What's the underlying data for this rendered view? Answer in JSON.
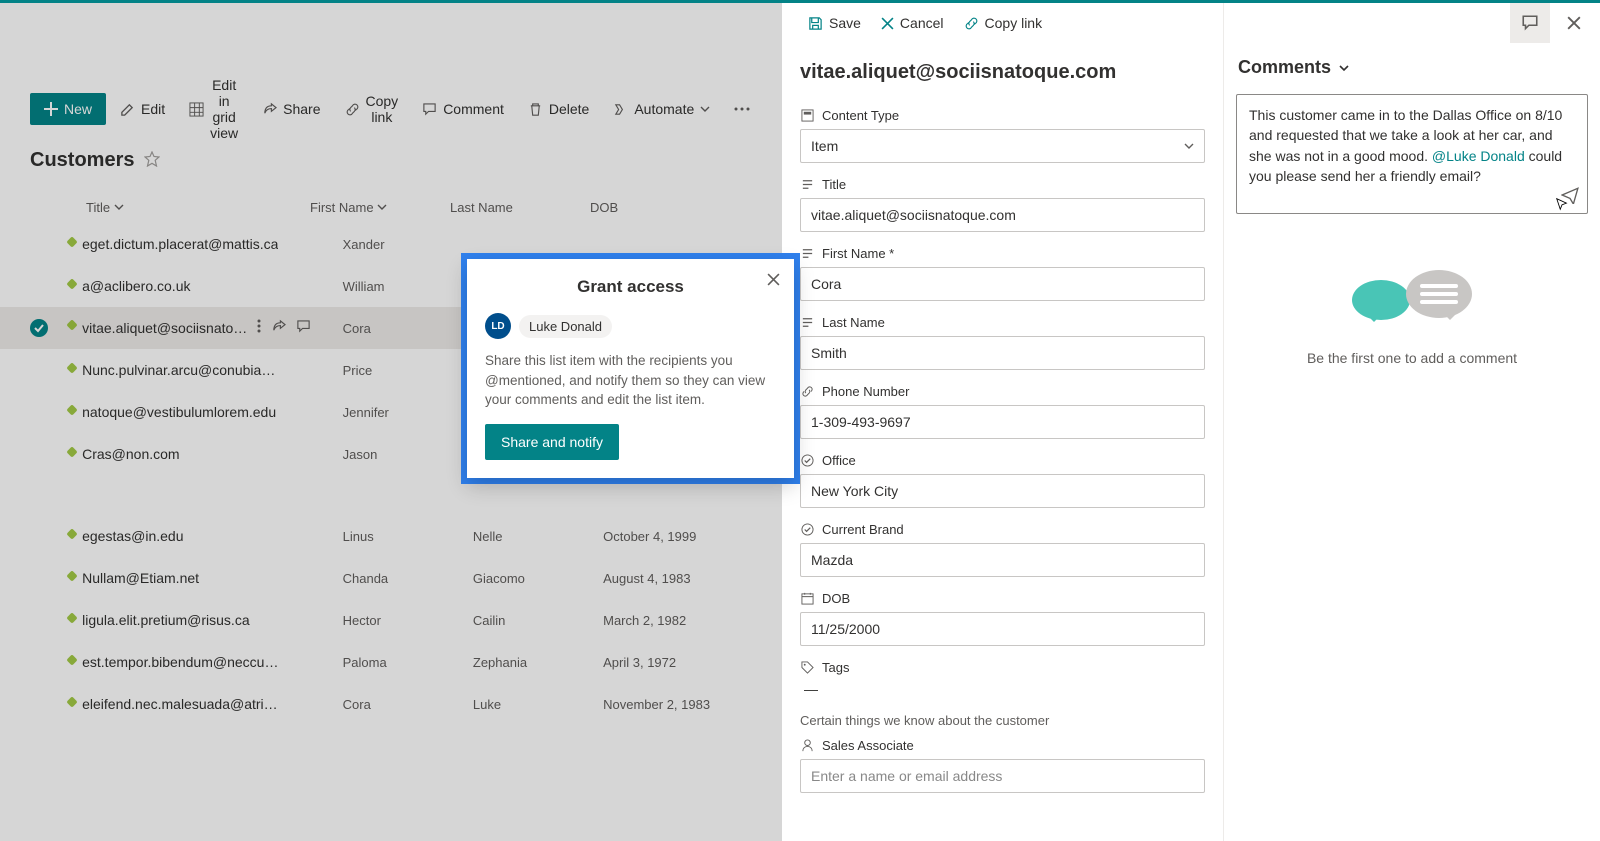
{
  "toolbar": {
    "new_label": "New",
    "edit_label": "Edit",
    "edit_grid_label": "Edit in grid view",
    "share_label": "Share",
    "copy_link_label": "Copy link",
    "comment_label": "Comment",
    "delete_label": "Delete",
    "automate_label": "Automate"
  },
  "list": {
    "title": "Customers",
    "columns": {
      "title": "Title",
      "first_name": "First Name",
      "last_name": "Last Name",
      "dob": "DOB"
    },
    "rows": [
      {
        "title": "eget.dictum.placerat@mattis.ca",
        "first_name": "Xander",
        "last_name": "",
        "dob": ""
      },
      {
        "title": "a@aclibero.co.uk",
        "first_name": "William",
        "last_name": "",
        "dob": ""
      },
      {
        "title": "vitae.aliquet@sociisnato…",
        "first_name": "Cora",
        "last_name": "",
        "dob": "",
        "selected": true
      },
      {
        "title": "Nunc.pulvinar.arcu@conubianostraper.edu",
        "first_name": "Price",
        "last_name": "",
        "dob": ""
      },
      {
        "title": "natoque@vestibulumlorem.edu",
        "first_name": "Jennifer",
        "last_name": "",
        "dob": ""
      },
      {
        "title": "Cras@non.com",
        "first_name": "Jason",
        "last_name": "",
        "dob": ""
      },
      {
        "title": "egestas@in.edu",
        "first_name": "Linus",
        "last_name": "Nelle",
        "dob": "October 4, 1999"
      },
      {
        "title": "Nullam@Etiam.net",
        "first_name": "Chanda",
        "last_name": "Giacomo",
        "dob": "August 4, 1983"
      },
      {
        "title": "ligula.elit.pretium@risus.ca",
        "first_name": "Hector",
        "last_name": "Cailin",
        "dob": "March 2, 1982"
      },
      {
        "title": "est.tempor.bibendum@neccursusa.com",
        "first_name": "Paloma",
        "last_name": "Zephania",
        "dob": "April 3, 1972"
      },
      {
        "title": "eleifend.nec.malesuada@atrisus.ca",
        "first_name": "Cora",
        "last_name": "Luke",
        "dob": "November 2, 1983"
      }
    ]
  },
  "panel_actions": {
    "save": "Save",
    "cancel": "Cancel",
    "copy_link": "Copy link"
  },
  "form": {
    "heading": "vitae.aliquet@sociisnatoque.com",
    "fields": {
      "content_type": {
        "label": "Content Type",
        "value": "Item"
      },
      "title": {
        "label": "Title",
        "value": "vitae.aliquet@sociisnatoque.com"
      },
      "first_name": {
        "label": "First Name *",
        "value": "Cora"
      },
      "last_name": {
        "label": "Last Name",
        "value": "Smith"
      },
      "phone": {
        "label": "Phone Number",
        "value": "1-309-493-9697"
      },
      "office": {
        "label": "Office",
        "value": "New York City"
      },
      "brand": {
        "label": "Current Brand",
        "value": "Mazda"
      },
      "dob": {
        "label": "DOB",
        "value": "11/25/2000"
      },
      "tags": {
        "label": "Tags",
        "value": "—"
      },
      "section_note": "Certain things we know about the customer",
      "sales_associate": {
        "label": "Sales Associate",
        "placeholder": "Enter a name or email address"
      }
    }
  },
  "comments": {
    "heading": "Comments",
    "draft_pre": "This customer came in to the Dallas Office on 8/10 and requested that we take a look at her car, and she was not in a good mood. ",
    "draft_mention": "@Luke Donald",
    "draft_post": " could you please send her a friendly email?",
    "empty_text": "Be the first one to add a comment"
  },
  "modal": {
    "title": "Grant access",
    "person_initials": "LD",
    "person_name": "Luke Donald",
    "body": "Share this list item with the recipients you @mentioned, and notify them so they can view your comments and edit the list item.",
    "primary": "Share and notify"
  }
}
